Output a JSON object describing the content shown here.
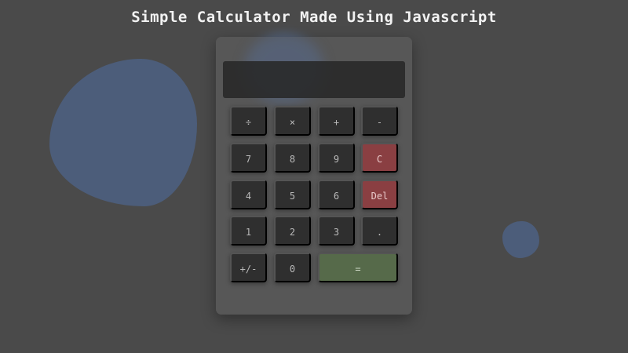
{
  "page": {
    "title": "Simple Calculator Made Using Javascript"
  },
  "calculator": {
    "display_value": "",
    "keys": {
      "divide": "÷",
      "multiply": "×",
      "add": "+",
      "subtract": "-",
      "seven": "7",
      "eight": "8",
      "nine": "9",
      "clear": "C",
      "four": "4",
      "five": "5",
      "six": "6",
      "delete": "Del",
      "one": "1",
      "two": "2",
      "three": "3",
      "decimal": ".",
      "negate": "+/-",
      "zero": "0",
      "equals": "="
    }
  },
  "colors": {
    "background": "#4a4a4a",
    "blob": "#4c5d7a",
    "calculator_body": "#585858",
    "display": "#282828",
    "key": "#2f2f2f",
    "key_text": "#b9b9b9",
    "danger_key": "#8a3f42",
    "equals_key": "#566a4a"
  }
}
